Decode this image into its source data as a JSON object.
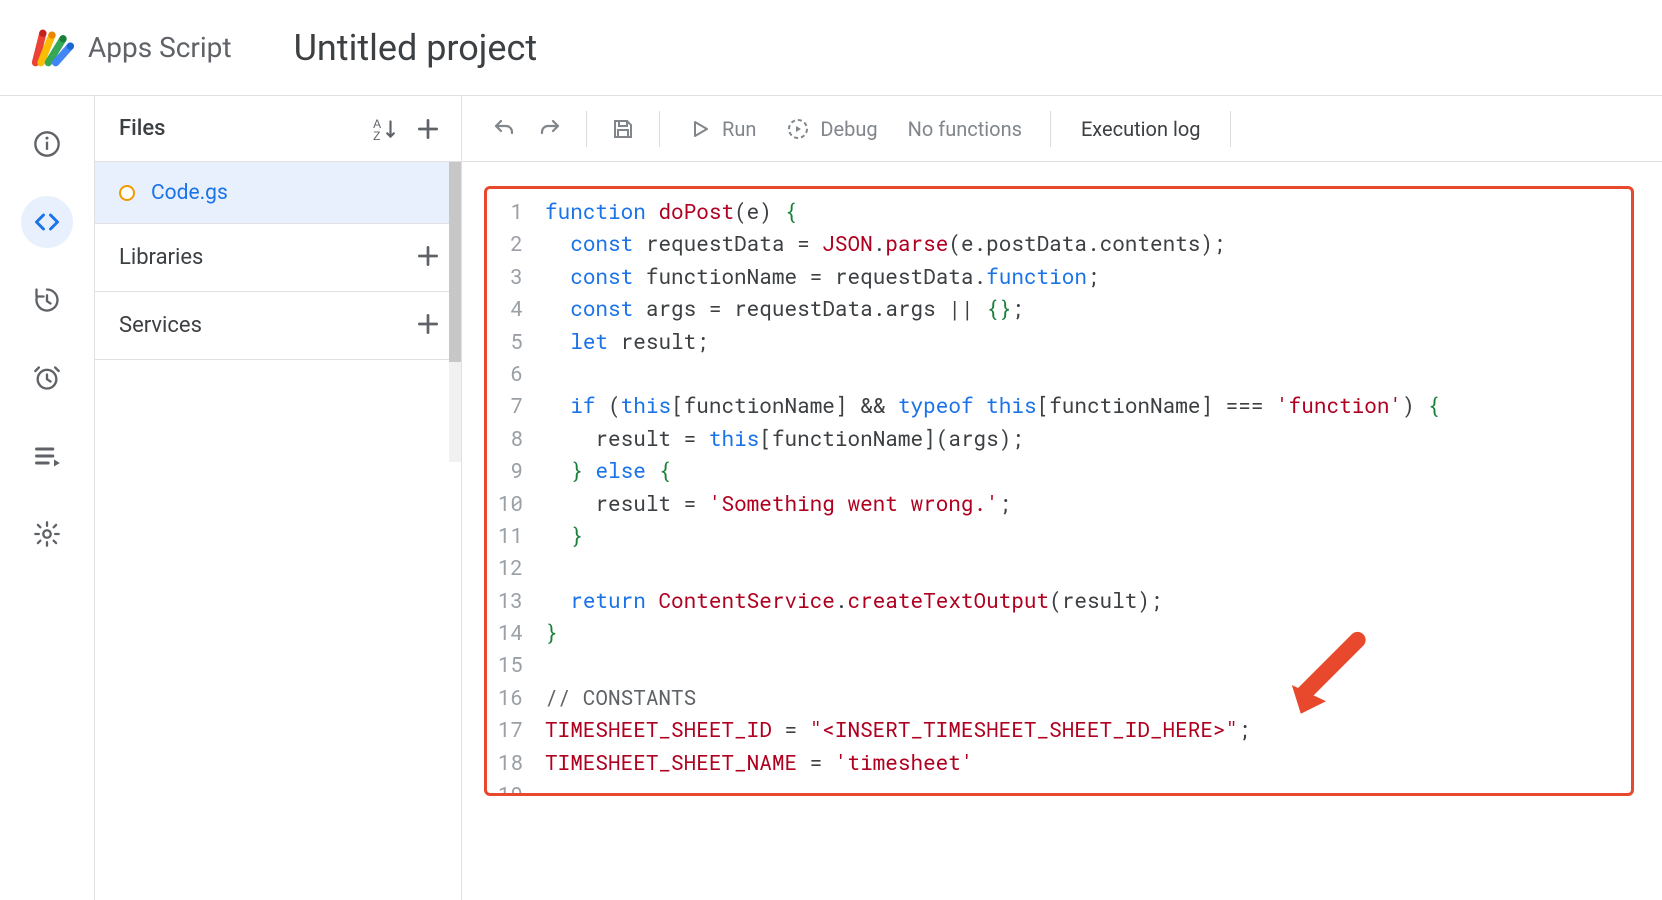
{
  "header": {
    "app_name": "Apps Script",
    "project_title": "Untitled project"
  },
  "sidebar": {
    "files_label": "Files",
    "file": "Code.gs",
    "libraries_label": "Libraries",
    "services_label": "Services"
  },
  "toolbar": {
    "run": "Run",
    "debug": "Debug",
    "func_selector": "No functions",
    "exec_log": "Execution log"
  },
  "code": {
    "lines": [
      "function doPost(e) {",
      "  const requestData = JSON.parse(e.postData.contents);",
      "  const functionName = requestData.function;",
      "  const args = requestData.args || {};",
      "  let result;",
      "",
      "  if (this[functionName] && typeof this[functionName] === 'function') {",
      "    result = this[functionName](args);",
      "  } else {",
      "    result = 'Something went wrong.';",
      "  }",
      "",
      "  return ContentService.createTextOutput(result);",
      "}",
      "",
      "// CONSTANTS",
      "TIMESHEET_SHEET_ID = \"<INSERT_TIMESHEET_SHEET_ID_HERE>\";",
      "TIMESHEET_SHEET_NAME = 'timesheet'",
      ""
    ],
    "line_count": 19
  }
}
